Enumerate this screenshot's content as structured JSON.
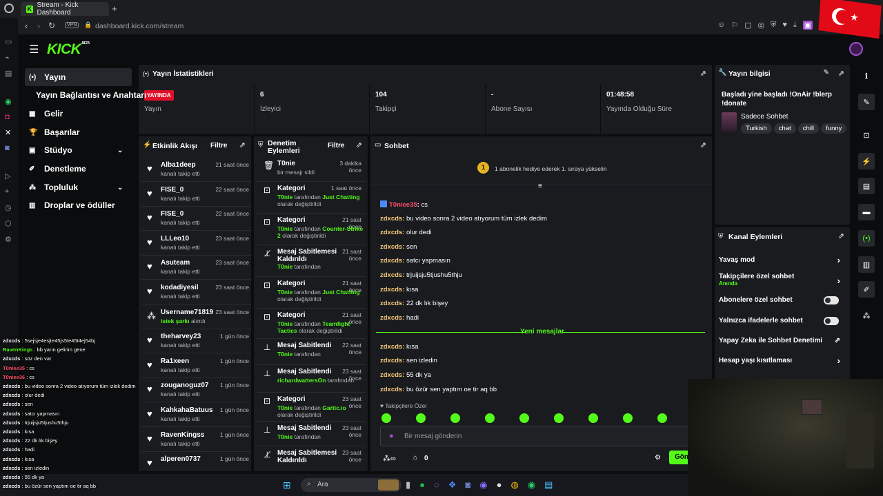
{
  "browser": {
    "tab_title": "Stream - Kick Dashboard",
    "vpn": "VPN",
    "url": "dashboard.kick.com/stream"
  },
  "brand": {
    "logo": "KICK",
    "beta": "BETA",
    "accent": "#53fc18"
  },
  "nav": [
    {
      "label": "Yayın",
      "icon": "broadcast-icon"
    },
    {
      "label": "Yayın Bağlantısı ve Anahtarı",
      "icon": ""
    },
    {
      "label": "Gelir",
      "icon": "revenue-icon"
    },
    {
      "label": "Başarılar",
      "icon": "trophy-icon"
    },
    {
      "label": "Stüdyo",
      "icon": "studio-icon",
      "chevron": true
    },
    {
      "label": "Denetleme",
      "icon": "wrench-icon"
    },
    {
      "label": "Topluluk",
      "icon": "community-icon",
      "chevron": true
    },
    {
      "label": "Droplar ve ödüller",
      "icon": "drops-icon"
    }
  ],
  "stats": {
    "title": "Yayın İstatistikleri",
    "items": [
      {
        "value": "YAYINDA",
        "label": "Yayın",
        "badge": true
      },
      {
        "value": "6",
        "label": "İzleyici"
      },
      {
        "value": "104",
        "label": "Takipçi"
      },
      {
        "value": "-",
        "label": "Abone Sayısı"
      },
      {
        "value": "01:48:58",
        "label": "Yayında Olduğu Süre"
      }
    ]
  },
  "info": {
    "title": "Yayın bilgisi",
    "stream_title_1": "Başladı yine başladı !OnAir !blerp",
    "stream_title_2": "!donate",
    "category": "Sadece Sohbet",
    "tags": [
      "Turkish",
      "chat",
      "chill",
      "funny"
    ]
  },
  "activity": {
    "title": "Etkinlik Akışı",
    "filter": "Filtre",
    "rows": [
      {
        "name": "Alba1deep",
        "sub": "kanalı takip etti",
        "time": "21 saat önce"
      },
      {
        "name": "FISE_0",
        "sub": "kanalı takip etti",
        "time": "22 saat önce"
      },
      {
        "name": "FISE_0",
        "sub": "kanalı takip etti",
        "time": "22 saat önce"
      },
      {
        "name": "LLLeo10",
        "sub": "kanalı takip etti",
        "time": "23 saat önce"
      },
      {
        "name": "Asuteam",
        "sub": "kanalı takip etti",
        "time": "23 saat önce"
      },
      {
        "name": "kodadiyesil",
        "sub": "kanalı takip etti",
        "time": "23 saat önce"
      },
      {
        "name": "Username71819",
        "sub": "istek şarkı",
        "sub2": " alındı",
        "time": "23 saat önce"
      },
      {
        "name": "theharvey23",
        "sub": "kanalı takip etti",
        "time": "1 gün önce"
      },
      {
        "name": "Ra1xeen",
        "sub": "kanalı takip etti",
        "time": "1 gün önce"
      },
      {
        "name": "zouganoguz07",
        "sub": "kanalı takip etti",
        "time": "1 gün önce"
      },
      {
        "name": "KahkahaBatuus",
        "sub": "kanalı takip etti",
        "time": "1 gün önce"
      },
      {
        "name": "RavenKingss",
        "sub": "kanalı takip etti",
        "time": "1 gün önce"
      },
      {
        "name": "alperen0737",
        "sub": "",
        "time": "1 gün önce"
      }
    ]
  },
  "moderation": {
    "title_1": "Denetim",
    "title_2": "Eylemleri",
    "filter": "Filtre",
    "tarafindan": "tarafından",
    "olarak": "olarak değiştirildi",
    "rows": [
      {
        "title": "T0nie",
        "line1": "bir mesajı sildi",
        "time": "3 dakika önce"
      },
      {
        "title": "Kategori",
        "user": "T0nie",
        "cat": "Just Chatting",
        "time": "1 saat önce"
      },
      {
        "title": "Kategori",
        "user": "T0nie",
        "cat": "Counter-Strike",
        "cat2": "2",
        "time": "21 saat önce"
      },
      {
        "title": "Mesaj Sabitlemesi Kaldırıldı",
        "user": "T0nie",
        "time": "21 saat önce"
      },
      {
        "title": "Kategori",
        "user": "T0nie",
        "cat": "Just Chatting",
        "time": "21 saat önce"
      },
      {
        "title": "Kategori",
        "user": "T0nie",
        "cat": "Teamfight",
        "cat2": "Tactics",
        "time": "21 saat önce"
      },
      {
        "title": "Mesaj Sabitlendi",
        "user": "T0nie",
        "time": "22 saat önce"
      },
      {
        "title": "Mesaj Sabitlendi",
        "user": "richardwattersOn",
        "time": "23 saat önce"
      },
      {
        "title": "Kategori",
        "user": "T0nie",
        "cat": "Gartic.io",
        "time": "23 saat önce"
      },
      {
        "title": "Mesaj Sabitlendi",
        "user": "T0nie",
        "time": "23 saat önce"
      },
      {
        "title": "Mesaj Sabitlemesi Kaldırıldı",
        "time": "23 saat önce"
      }
    ]
  },
  "chat": {
    "title": "Sohbet",
    "banner": "1 abonelik hediye ederek 1. sıraya yükselin",
    "banner_rank": "1",
    "new_messages": "Yeni mesajlar",
    "followers_only": "Takipçilere Özel",
    "placeholder": "Bir mesaj gönderin",
    "send": "Gönder",
    "points": "0",
    "messages_before": [
      {
        "user": "T0niee35",
        "text": "cs",
        "color": "#ff4d6d",
        "badge": true
      },
      {
        "user": "zdxcds",
        "text": "bu video sonra 2 video atıyorum tüm izlek dedim"
      },
      {
        "user": "zdxcds",
        "text": "olur dedi"
      },
      {
        "user": "zdxcds",
        "text": "sen"
      },
      {
        "user": "zdxcds",
        "text": "satcı yapmasın"
      },
      {
        "user": "zdxcds",
        "text": "trjuijsju5tjushu5thju"
      },
      {
        "user": "zdxcds",
        "text": "kısa"
      },
      {
        "user": "zdxcds",
        "text": "22 dk lık bişey"
      },
      {
        "user": "zdxcds",
        "text": "hadi"
      }
    ],
    "messages_after": [
      {
        "user": "zdxcds",
        "text": "kısa"
      },
      {
        "user": "zdxcds",
        "text": "sen izledin"
      },
      {
        "user": "zdxcds",
        "text": "55 dk ya"
      },
      {
        "user": "zdxcds",
        "text": "bu özür sen yaptım oe tir aq bb"
      }
    ]
  },
  "channel_actions": {
    "title": "Kanal Eylemleri",
    "items": [
      {
        "label": "Yavaş mod",
        "type": "chevron"
      },
      {
        "label": "Takipçilere özel sohbet",
        "sub": "Anında",
        "type": "chevron"
      },
      {
        "label": "Abonelere özel sohbet",
        "type": "toggle"
      },
      {
        "label": "Yalnızca ifadelerle sohbet",
        "type": "toggle"
      },
      {
        "label": "Yapay Zeka ile Sohbet Denetimi",
        "type": "external"
      },
      {
        "label": "Hesap yaşı kısıtlaması",
        "type": "chevron"
      }
    ]
  },
  "overlay_chat": [
    {
      "user": "zdxcds",
      "text": "5sejsje4esjte45js5te45t4ej54bj"
    },
    {
      "user": "RavenKings",
      "text": "bb yarın gelirim gene"
    },
    {
      "user": "zdxcds",
      "text": "söz den var"
    },
    {
      "user": "T0niee35",
      "text": "cs"
    },
    {
      "user": "T0niee36",
      "text": "cs"
    },
    {
      "user": "zdxcds",
      "text": "bu video sonra 2 video atıyorum tüm izlek dedim"
    },
    {
      "user": "zdxcds",
      "text": "olur dedi"
    },
    {
      "user": "zdxcds",
      "text": "sen"
    },
    {
      "user": "zdxcds",
      "text": "satcı yapmasın"
    },
    {
      "user": "zdxcds",
      "text": "trjuijsju5tjushu5thju"
    },
    {
      "user": "zdxcds",
      "text": "kısa"
    },
    {
      "user": "zdxcds",
      "text": "22 dk lık bişey"
    },
    {
      "user": "zdxcds",
      "text": "hadi"
    },
    {
      "user": "zdxcds",
      "text": "kısa"
    },
    {
      "user": "zdxcds",
      "text": "sen izledin"
    },
    {
      "user": "zdxcds",
      "text": "55 dk ya"
    },
    {
      "user": "zdxcds",
      "text": "bu özür sen yaptım oe tir aq bb"
    }
  ],
  "taskbar": {
    "search": "Ara"
  }
}
